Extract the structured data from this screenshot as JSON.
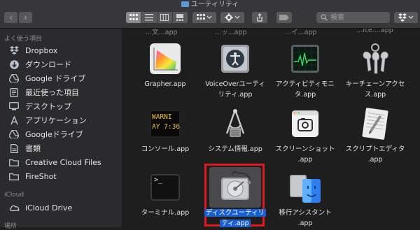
{
  "window": {
    "title": "ユーティリティ",
    "search_placeholder": "検索"
  },
  "sidebar": {
    "favorites_header": "よく使う項目",
    "favorites": [
      {
        "label": "Dropbox",
        "icon": "dropbox-icon"
      },
      {
        "label": "ダウンロード",
        "icon": "download-icon"
      },
      {
        "label": "Google ドライブ",
        "icon": "google-drive-icon"
      },
      {
        "label": "最近使った項目",
        "icon": "recents-icon"
      },
      {
        "label": "デスクトップ",
        "icon": "desktop-icon"
      },
      {
        "label": "アプリケーション",
        "icon": "applications-icon"
      },
      {
        "label": "Googleドライブ",
        "icon": "google-drive-icon"
      },
      {
        "label": "書類",
        "icon": "documents-icon"
      },
      {
        "label": "Creative Cloud Files",
        "icon": "folder-icon"
      },
      {
        "label": "FireShot",
        "icon": "folder-icon"
      }
    ],
    "icloud_header": "iCloud",
    "icloud_items": [
      {
        "label": "iCloud Drive",
        "icon": "cloud-icon"
      }
    ],
    "places_header": "場所"
  },
  "files": {
    "partial_top": [
      "...文...app",
      "...ッ...app",
      "...イ...app",
      "...ice....app"
    ],
    "items": [
      {
        "line1": "Grapher.app",
        "line2": "",
        "icon": "grapher-icon",
        "selected": false
      },
      {
        "line1": "VoiceOverユーティ",
        "line2": "リティ.app",
        "icon": "voiceover-icon",
        "selected": false
      },
      {
        "line1": "アクティビティモニ",
        "line2": "タ.app",
        "icon": "activity-monitor-icon",
        "selected": false
      },
      {
        "line1": "キーチェーンアクセ",
        "line2": "ス.app",
        "icon": "keychain-icon",
        "selected": false
      },
      {
        "line1": "コンソール.app",
        "line2": "",
        "icon": "console-icon",
        "selected": false
      },
      {
        "line1": "システム情報.app",
        "line2": "",
        "icon": "system-info-icon",
        "selected": false
      },
      {
        "line1": "スクリーンショット",
        "line2": ".app",
        "icon": "screenshot-icon",
        "selected": false
      },
      {
        "line1": "スクリプトエディタ",
        "line2": ".app",
        "icon": "script-editor-icon",
        "selected": false
      },
      {
        "line1": "ターミナル.app",
        "line2": "",
        "icon": "terminal-icon",
        "selected": false
      },
      {
        "line1": "ディスクユーティリ",
        "line2": "ティ.app",
        "icon": "disk-utility-icon",
        "selected": true
      },
      {
        "line1": "移行アシスタント",
        "line2": ".app",
        "icon": "migration-assistant-icon",
        "selected": false
      }
    ],
    "console_text": [
      "WARNI",
      "AY 7:36"
    ],
    "terminal_prompt": ">_"
  },
  "colors": {
    "selection": "#1a5fd2",
    "highlight_box": "#e0191e"
  }
}
